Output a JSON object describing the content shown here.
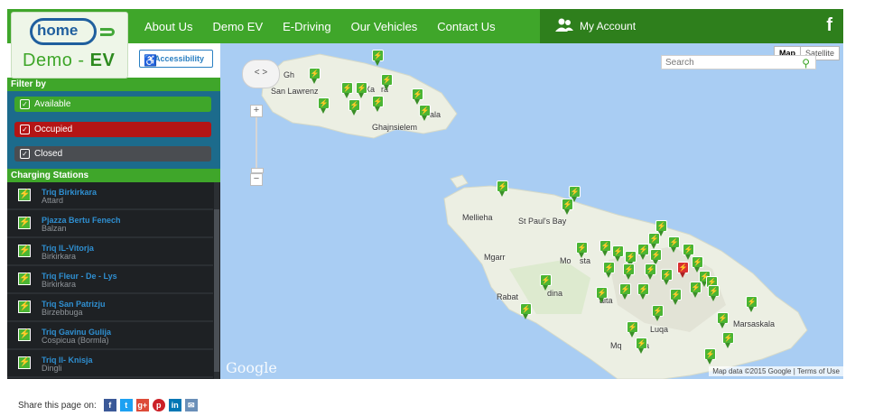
{
  "brand": {
    "logo_word": "home",
    "subtitle_demo": "Demo",
    "subtitle_ev": "EV"
  },
  "nav": {
    "items": [
      "About Us",
      "Demo EV",
      "E-Driving",
      "Our Vehicles",
      "Contact Us"
    ]
  },
  "account": {
    "label": "My Account",
    "facebook": "f",
    "icon": "users-icon"
  },
  "accessibility": {
    "label": "Accessibility"
  },
  "filter": {
    "heading": "Filter by",
    "options": [
      {
        "label": "Available",
        "color": "#3fa62a",
        "checked": true
      },
      {
        "label": "Occupied",
        "color": "#b41515",
        "checked": true
      },
      {
        "label": "Closed",
        "color": "#4a4d51",
        "checked": true
      }
    ]
  },
  "stations": {
    "heading": "Charging Stations",
    "items": [
      {
        "name": "Triq Birkirkara",
        "city": "Attard"
      },
      {
        "name": "Pjazza Bertu Fenech",
        "city": "Balzan"
      },
      {
        "name": "Triq IL-Vitorja",
        "city": "Birkirkara"
      },
      {
        "name": "Triq Fleur - De - Lys",
        "city": "Birkirkara"
      },
      {
        "name": "Triq San Patrizju",
        "city": "Birzebbuga"
      },
      {
        "name": "Triq Gavinu Gulija",
        "city": "Cospicua (Bormla)"
      },
      {
        "name": "Triq Il- Knisja",
        "city": "Dingli"
      }
    ]
  },
  "map": {
    "type_map": "Map",
    "type_satellite": "Satellite",
    "search_placeholder": "Search",
    "zoom_in": "+",
    "zoom_out": "−",
    "pan_arrows": "< >",
    "google": "Google",
    "attribution": "Map data ©2015 Google",
    "terms": "Terms of Use",
    "places": [
      "Gh",
      "San Lawrenz",
      "Xa",
      "ra",
      "ala",
      "Ghajnsielem",
      "Mellieha",
      "St Paul's Bay",
      "Mgarr",
      "Mo",
      "sta",
      "Rabat",
      "dina",
      "alta",
      "Luqa",
      "Marsaskala",
      "Mq",
      "a"
    ]
  },
  "share": {
    "label": "Share this page on:",
    "networks": [
      {
        "icon": "facebook-icon",
        "glyph": "f",
        "color": "#3b5998"
      },
      {
        "icon": "twitter-icon",
        "glyph": "t",
        "color": "#1da1f2"
      },
      {
        "icon": "google-plus-icon",
        "glyph": "g+",
        "color": "#dd4b39"
      },
      {
        "icon": "pinterest-icon",
        "glyph": "p",
        "color": "#cb2027"
      },
      {
        "icon": "linkedin-icon",
        "glyph": "in",
        "color": "#0077b5"
      },
      {
        "icon": "email-icon",
        "glyph": "✉",
        "color": "#6a8fb8"
      }
    ]
  }
}
